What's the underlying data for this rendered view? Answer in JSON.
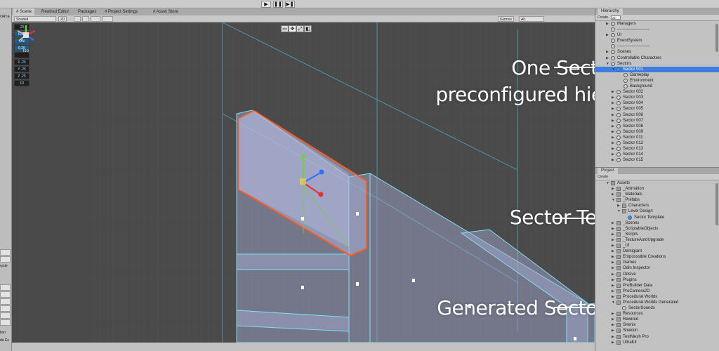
{
  "playbar": {
    "play_icon": "play-icon",
    "pause_icon": "pause-icon",
    "step_icon": "step-icon",
    "play": "▶",
    "pause": "❚❚",
    "step": "▶❚"
  },
  "tabs": [
    {
      "label": "# Scene"
    },
    {
      "label": "Rewired Editor"
    },
    {
      "label": "Packages"
    },
    {
      "label": "# Project Settings"
    },
    {
      "label": "# Asset Store"
    }
  ],
  "scene_toolbar": {
    "shading": "Shaded",
    "mode_2d": "2D",
    "gizmos": "Gizmos",
    "search": "All"
  },
  "left_edge": {
    "label_top": "ORTE",
    "label_mid": "ryste",
    "label_low": "tion",
    "label_bottom": "de Ex"
  },
  "snap_settings": [
    {
      "label": ".25",
      "active": false
    },
    {
      "label": "0.25",
      "active": true
    },
    {
      "label": "ON",
      "active": true
    },
    {
      "label": "0.25",
      "active": true
    },
    {
      "label": "",
      "active": false
    },
    {
      "label": "X .25",
      "active": false
    },
    {
      "label": "Y .25",
      "active": false
    },
    {
      "label": "Z .25",
      "active": false
    },
    {
      "label": "3D",
      "active": false
    }
  ],
  "tools": [
    "▭",
    "✥",
    "⤢",
    "◧"
  ],
  "gizmo_label": "Iso",
  "callouts": {
    "one_sector": [
      "One Sector with",
      "preconfigured hierarchy"
    ],
    "template": "Sector Template",
    "mesh": "Generated Sector mesh"
  },
  "hierarchy": {
    "tab": "Hierarchy",
    "create": "Create",
    "search": "All",
    "rows": [
      {
        "label": "Managers",
        "indent": 2,
        "arrow": "▶",
        "icon": "obj"
      },
      {
        "label": "-----------------------",
        "indent": 2,
        "arrow": "",
        "icon": "obj"
      },
      {
        "label": "UI",
        "indent": 2,
        "arrow": "▶",
        "icon": "obj"
      },
      {
        "label": "EventSystem",
        "indent": 2,
        "arrow": "",
        "icon": "obj"
      },
      {
        "label": "-----------------------",
        "indent": 2,
        "arrow": "",
        "icon": "obj"
      },
      {
        "label": "Scenes",
        "indent": 2,
        "arrow": "▶",
        "icon": "obj"
      },
      {
        "label": "Controllable Characters",
        "indent": 2,
        "arrow": "▶",
        "icon": "obj"
      },
      {
        "label": "Sectors",
        "indent": 2,
        "arrow": "▼",
        "icon": "obj"
      },
      {
        "label": "Sector 001",
        "indent": 10,
        "arrow": "▼",
        "icon": "prefab",
        "selected": true
      },
      {
        "label": "Gameplay",
        "indent": 20,
        "arrow": "",
        "icon": "obj"
      },
      {
        "label": "Environment",
        "indent": 20,
        "arrow": "",
        "icon": "obj"
      },
      {
        "label": "Background",
        "indent": 20,
        "arrow": "",
        "icon": "obj"
      },
      {
        "label": "Sector 002",
        "indent": 10,
        "arrow": "▶",
        "icon": "obj"
      },
      {
        "label": "Sector 003",
        "indent": 10,
        "arrow": "▶",
        "icon": "obj"
      },
      {
        "label": "Sector 004",
        "indent": 10,
        "arrow": "▶",
        "icon": "obj"
      },
      {
        "label": "Sector 005",
        "indent": 10,
        "arrow": "▶",
        "icon": "obj"
      },
      {
        "label": "Sector 006",
        "indent": 10,
        "arrow": "▶",
        "icon": "obj"
      },
      {
        "label": "Sector 007",
        "indent": 10,
        "arrow": "▶",
        "icon": "obj"
      },
      {
        "label": "Sector 008",
        "indent": 10,
        "arrow": "▶",
        "icon": "obj"
      },
      {
        "label": "Sector 009",
        "indent": 10,
        "arrow": "▶",
        "icon": "obj"
      },
      {
        "label": "Sector 011",
        "indent": 10,
        "arrow": "▶",
        "icon": "obj"
      },
      {
        "label": "Sector 012",
        "indent": 10,
        "arrow": "▶",
        "icon": "obj"
      },
      {
        "label": "Sector 013",
        "indent": 10,
        "arrow": "▶",
        "icon": "obj"
      },
      {
        "label": "Sector 014",
        "indent": 10,
        "arrow": "▶",
        "icon": "obj"
      },
      {
        "label": "Sector 015",
        "indent": 10,
        "arrow": "▶",
        "icon": "obj"
      }
    ]
  },
  "project": {
    "tab": "Project",
    "create": "Create",
    "rows": [
      {
        "label": "Assets",
        "indent": 2,
        "arrow": "▼",
        "icon": "folder"
      },
      {
        "label": "_Animation",
        "indent": 10,
        "arrow": "▶",
        "icon": "folder"
      },
      {
        "label": "_Materials",
        "indent": 10,
        "arrow": "▶",
        "icon": "folder"
      },
      {
        "label": "_Prefabs",
        "indent": 10,
        "arrow": "▼",
        "icon": "folder"
      },
      {
        "label": "Characters",
        "indent": 18,
        "arrow": "▶",
        "icon": "folder"
      },
      {
        "label": "Level Design",
        "indent": 18,
        "arrow": "▼",
        "icon": "folder"
      },
      {
        "label": "Sector Template",
        "indent": 26,
        "arrow": "",
        "icon": "prefab"
      },
      {
        "label": "_Scenes",
        "indent": 10,
        "arrow": "▶",
        "icon": "folder"
      },
      {
        "label": "_ScriptableObjects",
        "indent": 10,
        "arrow": "▶",
        "icon": "folder"
      },
      {
        "label": "_Scripts",
        "indent": 10,
        "arrow": "▶",
        "icon": "folder"
      },
      {
        "label": "_TextureAutoUpgrade",
        "indent": 10,
        "arrow": "▶",
        "icon": "folder"
      },
      {
        "label": "_UI",
        "indent": 10,
        "arrow": "▶",
        "icon": "folder"
      },
      {
        "label": "Demigiant",
        "indent": 10,
        "arrow": "▶",
        "icon": "folder"
      },
      {
        "label": "Emposssible Creations",
        "indent": 10,
        "arrow": "▶",
        "icon": "folder"
      },
      {
        "label": "Games",
        "indent": 10,
        "arrow": "▶",
        "icon": "folder"
      },
      {
        "label": "Odin Inspector",
        "indent": 10,
        "arrow": "▶",
        "icon": "folder"
      },
      {
        "label": "Odsive",
        "indent": 10,
        "arrow": "▶",
        "icon": "folder"
      },
      {
        "label": "Plugins",
        "indent": 10,
        "arrow": "▶",
        "icon": "folder"
      },
      {
        "label": "ProBuilder Data",
        "indent": 10,
        "arrow": "▶",
        "icon": "folder"
      },
      {
        "label": "ProCamera2D",
        "indent": 10,
        "arrow": "▶",
        "icon": "folder"
      },
      {
        "label": "Procedural Worlds",
        "indent": 10,
        "arrow": "▶",
        "icon": "folder"
      },
      {
        "label": "Procedural Worlds Generated",
        "indent": 10,
        "arrow": "▼",
        "icon": "folder"
      },
      {
        "label": "SectorSounds",
        "indent": 18,
        "arrow": "",
        "icon": "obj"
      },
      {
        "label": "Resources",
        "indent": 10,
        "arrow": "▶",
        "icon": "folder"
      },
      {
        "label": "Rewired",
        "indent": 10,
        "arrow": "▶",
        "icon": "folder"
      },
      {
        "label": "Sirenix",
        "indent": 10,
        "arrow": "▶",
        "icon": "folder"
      },
      {
        "label": "Shekkin",
        "indent": 10,
        "arrow": "▶",
        "icon": "folder"
      },
      {
        "label": "TextMesh Pro",
        "indent": 10,
        "arrow": "▶",
        "icon": "folder"
      },
      {
        "label": "UltraKit",
        "indent": 10,
        "arrow": "▶",
        "icon": "folder"
      }
    ]
  }
}
